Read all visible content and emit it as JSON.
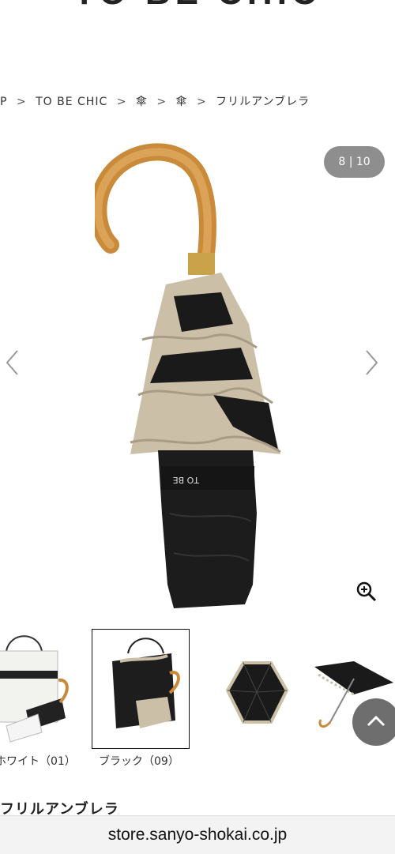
{
  "header": {
    "logo_text": "TO BE CHIC"
  },
  "breadcrumb": {
    "items": [
      "P",
      "TO BE CHIC",
      "傘",
      "傘",
      "フリルアンブレラ"
    ],
    "separator": ">"
  },
  "gallery": {
    "counter_current": "8",
    "counter_divider": "|",
    "counter_total": "10",
    "prev_icon": "chevron-left-icon",
    "next_icon": "chevron-right-icon",
    "zoom_icon": "zoom-in-icon"
  },
  "thumbnails": [
    {
      "label": "ホワイト（01）",
      "selected": false
    },
    {
      "label": "ブラック（09）",
      "selected": true
    },
    {
      "label": "",
      "selected": false
    },
    {
      "label": "",
      "selected": false
    }
  ],
  "product": {
    "name": "フリルアンブレラ"
  },
  "browser": {
    "url": "store.sanyo-shokai.co.jp"
  },
  "colors": {
    "counter_bg": "#8e8e8e",
    "scroll_top_bg": "#6e6e6e",
    "beige": "#cbbfa8",
    "black": "#1a1a1a"
  }
}
